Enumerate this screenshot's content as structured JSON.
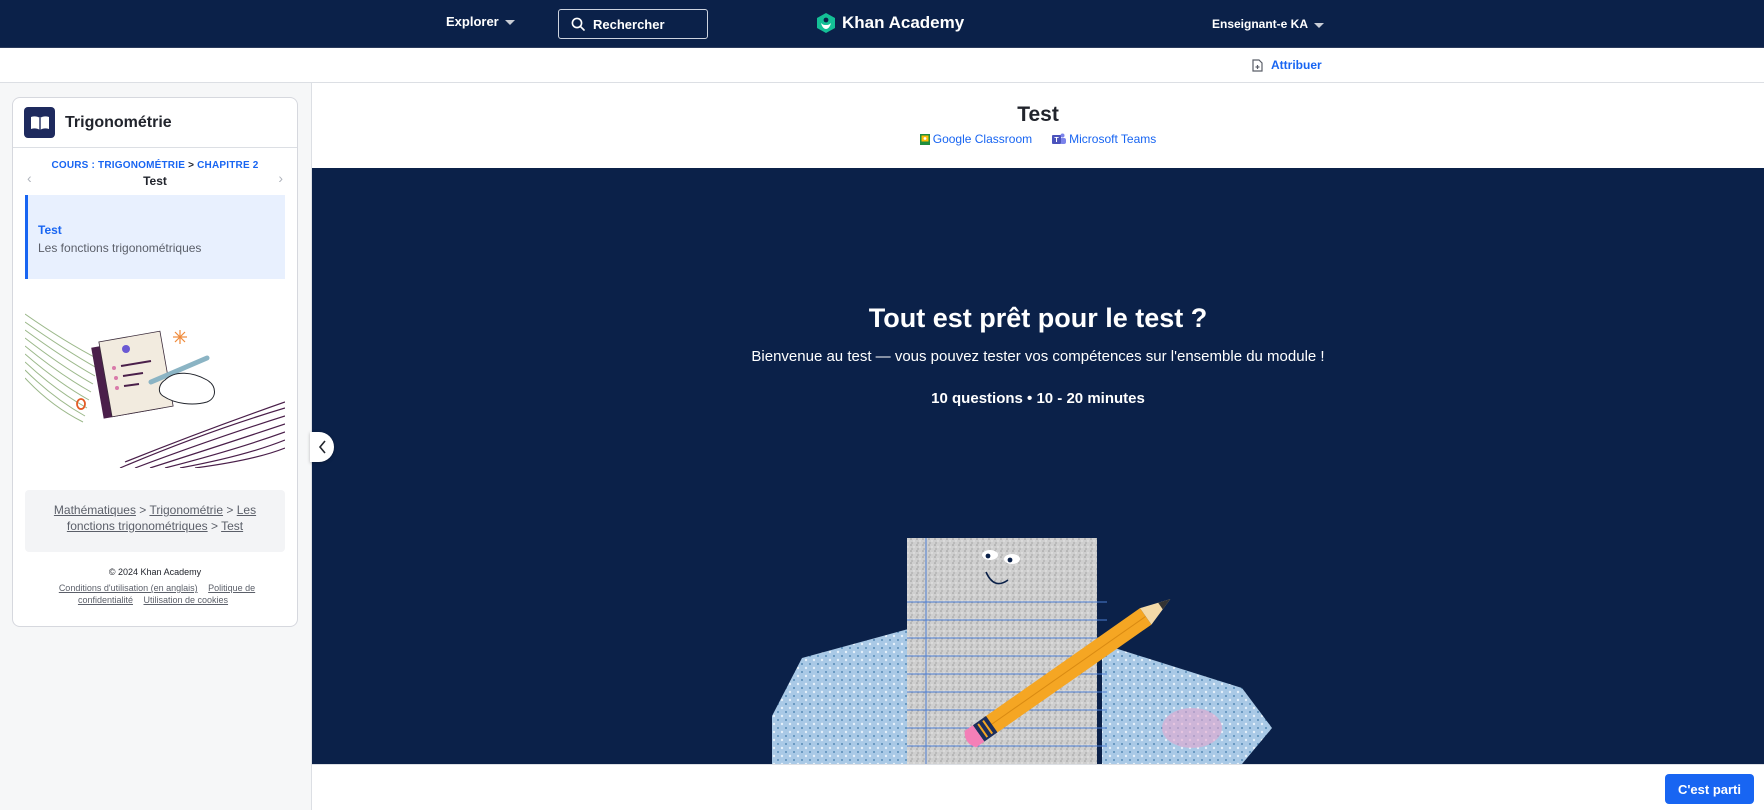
{
  "nav": {
    "explore_label": "Explorer",
    "search_label": "Rechercher",
    "logo_text": "Khan Academy",
    "user_label": "Enseignant-e KA",
    "brand_color": "#0b2149",
    "logo_color": "#14bf96"
  },
  "subbar": {
    "assign_label": "Attribuer"
  },
  "sidebar": {
    "course_title": "Trigonométrie",
    "breadcrumb_course": "COURS : TRIGONOMÉTRIE",
    "breadcrumb_sep": ">",
    "breadcrumb_chapter": "CHAPITRE 2",
    "current_item": "Test",
    "active_item": {
      "title": "Test",
      "subtitle": "Les fonctions trigonométriques"
    },
    "path": {
      "items": [
        "Mathématiques",
        "Trigonométrie",
        "Les fonctions trigonométriques",
        "Test"
      ],
      "sep": ">"
    },
    "copyright": "© 2024 Khan Academy",
    "legal": {
      "terms": "Conditions d'utilisation (en anglais)",
      "privacy": "Politique de confidentialité",
      "cookies": "Utilisation de cookies"
    }
  },
  "main": {
    "title": "Test",
    "share": {
      "google": "Google Classroom",
      "teams": "Microsoft Teams"
    },
    "hero": {
      "title": "Tout est prêt pour le test ?",
      "subtitle": "Bienvenue au test — vous pouvez tester vos compétences sur l'ensemble du module !",
      "meta": "10 questions • 10 - 20 minutes"
    },
    "start_button": "C'est parti",
    "accent_color": "#1865f2"
  }
}
